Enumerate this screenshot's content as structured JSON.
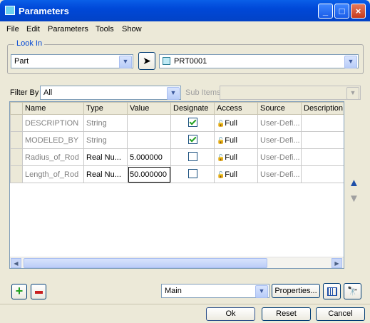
{
  "window": {
    "title": "Parameters",
    "minimize_icon": "minimize-icon",
    "maximize_icon": "maximize-icon",
    "close_icon": "close-icon"
  },
  "menu": [
    "File",
    "Edit",
    "Parameters",
    "Tools",
    "Show"
  ],
  "look_in": {
    "label": "Look In",
    "type_value": "Part",
    "model_value": "PRT0001",
    "select_icon": "arrow-cursor-icon"
  },
  "filter": {
    "label": "Filter By",
    "value": "All",
    "sub_items_label": "Sub Items",
    "sub_items_value": ""
  },
  "table": {
    "columns": [
      "Name",
      "Type",
      "Value",
      "Designate",
      "Access",
      "Source",
      "Description"
    ],
    "rows": [
      {
        "name": "DESCRIPTION",
        "type": "String",
        "value": "",
        "designate": true,
        "access": "Full",
        "source": "User-Defi...",
        "description": ""
      },
      {
        "name": "MODELED_BY",
        "type": "String",
        "value": "",
        "designate": true,
        "access": "Full",
        "source": "User-Defi...",
        "description": ""
      },
      {
        "name": "Radius_of_Rod",
        "type": "Real Nu...",
        "value": "5.000000",
        "designate": false,
        "access": "Full",
        "source": "User-Defi...",
        "description": ""
      },
      {
        "name": "Length_of_Rod",
        "type": "Real Nu...",
        "value": "50.000000",
        "designate": false,
        "access": "Full",
        "source": "User-Defi...",
        "description": ""
      }
    ]
  },
  "bottom": {
    "main_value": "Main",
    "properties_label": "Properties..."
  },
  "footer": {
    "ok": "Ok",
    "reset": "Reset",
    "cancel": "Cancel"
  },
  "colors": {
    "titlebar": "#0048D8",
    "frame_label": "#0046D5",
    "add": "#21A121",
    "remove": "#C81E1E"
  }
}
